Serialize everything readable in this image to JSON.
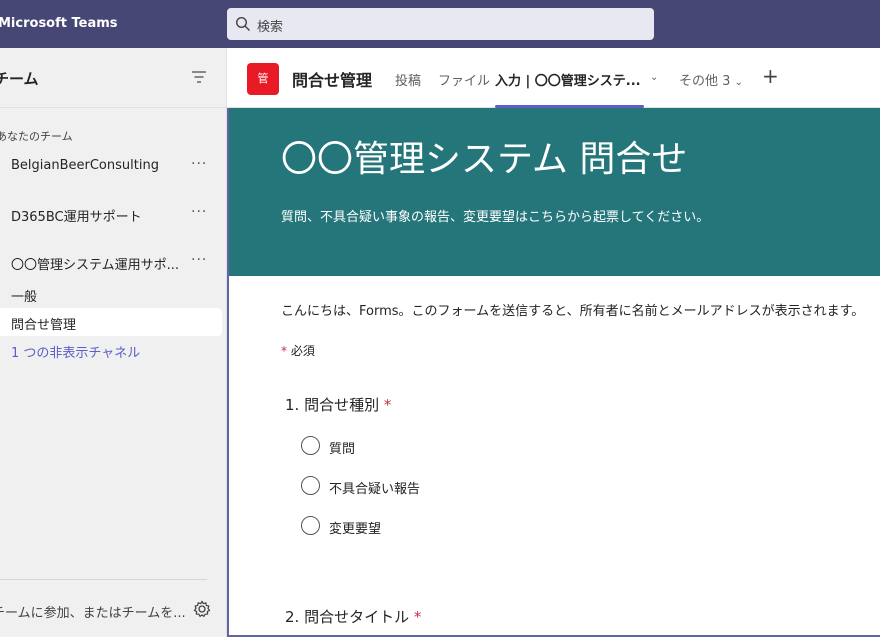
{
  "app": {
    "title": "Microsoft Teams"
  },
  "search": {
    "placeholder": "検索"
  },
  "sidebar": {
    "header_title": "チーム",
    "section_label": "あなたのチーム",
    "teams": [
      {
        "name": "BelgianBeerConsulting"
      },
      {
        "name": "D365BC運用サポート"
      },
      {
        "name": "〇〇管理システム運用サポ..."
      }
    ],
    "channels": [
      {
        "name": "一般"
      },
      {
        "name": "問合せ管理"
      }
    ],
    "hidden_channels": "1 つの非表示チャネル",
    "footer": "チームに参加、またはチームを..."
  },
  "channel_header": {
    "avatar_text": "管",
    "title": "問合せ管理",
    "tabs": [
      {
        "label": "投稿"
      },
      {
        "label": "ファイル"
      },
      {
        "label": "入力 | 〇〇管理システ..."
      },
      {
        "label": "その他 3"
      }
    ]
  },
  "form": {
    "title": "〇〇管理システム 問合せ",
    "description": "質問、不具合疑い事象の報告、変更要望はこちらから起票してください。",
    "intro": "こんにちは、Forms。このフォームを送信すると、所有者に名前とメールアドレスが表示されます。",
    "required_label": "必須",
    "q1": {
      "label": "1. 問合せ種別",
      "options": [
        "質問",
        "不具合疑い報告",
        "変更要望"
      ]
    },
    "q2": {
      "label": "2. 問合せタイトル"
    }
  },
  "colors": {
    "topbar": "#464775",
    "banner": "#25767a",
    "accent": "#5b5fc7",
    "required": "#c4314b"
  }
}
